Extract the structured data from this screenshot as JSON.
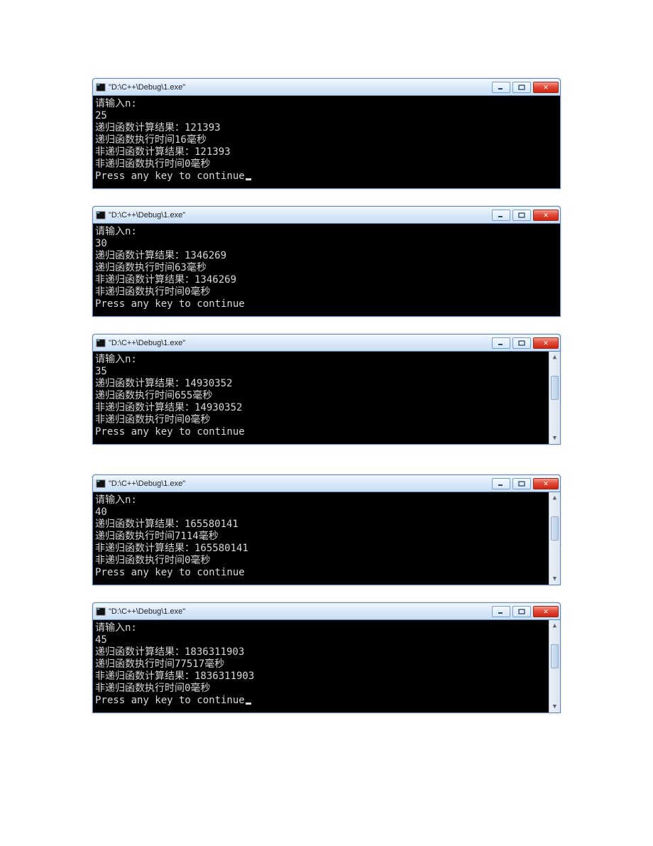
{
  "windows": [
    {
      "title": "\"D:\\C++\\Debug\\1.exe\"",
      "show_scrollbar": false,
      "show_cursor": true,
      "lines": [
        "请输入n:",
        "25",
        "递归函数计算结果：121393",
        "递归函数执行时间16毫秒",
        "非递归函数计算结果：121393",
        "非递归函数执行时间0毫秒",
        "Press any key to continue"
      ]
    },
    {
      "title": "\"D:\\C++\\Debug\\1.exe\"",
      "show_scrollbar": false,
      "show_cursor": false,
      "lines": [
        "请输入n:",
        "30",
        "递归函数计算结果：1346269",
        "递归函数执行时间63毫秒",
        "非递归函数计算结果：1346269",
        "非递归函数执行时间0毫秒",
        "Press any key to continue"
      ]
    },
    {
      "title": "\"D:\\C++\\Debug\\1.exe\"",
      "show_scrollbar": true,
      "show_cursor": false,
      "lines": [
        "请输入n:",
        "35",
        "递归函数计算结果：14930352",
        "递归函数执行时间655毫秒",
        "非递归函数计算结果：14930352",
        "非递归函数执行时间0毫秒",
        "Press any key to continue"
      ]
    },
    {
      "title": "\"D:\\C++\\Debug\\1.exe\"",
      "show_scrollbar": true,
      "show_cursor": false,
      "lines": [
        "请输入n:",
        "40",
        "递归函数计算结果：165580141",
        "递归函数执行时间7114毫秒",
        "非递归函数计算结果：165580141",
        "非递归函数执行时间0毫秒",
        "Press any key to continue"
      ]
    },
    {
      "title": "\"D:\\C++\\Debug\\1.exe\"",
      "show_scrollbar": true,
      "show_cursor": true,
      "lines": [
        "请输入n:",
        "45",
        "递归函数计算结果：1836311903",
        "递归函数执行时间77517毫秒",
        "非递归函数计算结果：1836311903",
        "非递归函数执行时间0毫秒",
        "Press any key to continue"
      ]
    }
  ]
}
